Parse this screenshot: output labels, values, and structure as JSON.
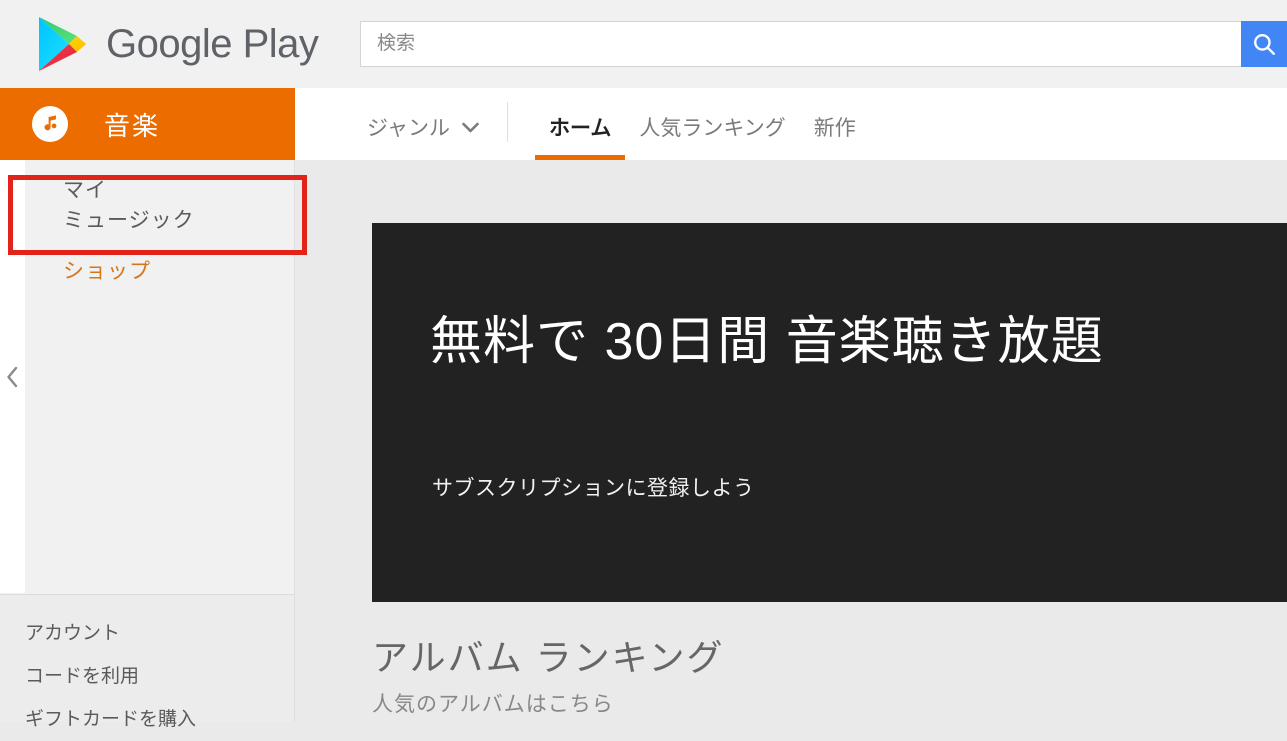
{
  "header": {
    "brand_name": "Google Play",
    "logo_icon": "google-play-triangle-icon",
    "search": {
      "placeholder": "検索",
      "value": "",
      "button_icon": "search-icon",
      "button_color": "#4285f4"
    }
  },
  "corpus": {
    "icon": "music-note-icon",
    "title": "音楽",
    "bar_color": "#ec6c00"
  },
  "nav": {
    "genre": {
      "label": "ジャンル",
      "caret_icon": "chevron-down-icon"
    },
    "tabs": [
      {
        "label": "ホーム",
        "active": true
      },
      {
        "label": "人気ランキング",
        "active": false
      },
      {
        "label": "新作",
        "active": false
      }
    ],
    "active_underline_color": "#ec6c00"
  },
  "sidebar": {
    "collapse_icon": "chevron-left-icon",
    "items": [
      {
        "label": "マイ\nミュージック",
        "line1": "マイ",
        "line2": "ミュージック",
        "highlighted": true
      },
      {
        "label": "ショップ",
        "highlighted": false
      }
    ],
    "footer_items": [
      {
        "label": "アカウント"
      },
      {
        "label": "コードを利用"
      },
      {
        "label": "ギフトカードを購入"
      }
    ],
    "highlight_color": "#e2231a",
    "shop_color": "#d4761a"
  },
  "main": {
    "hero": {
      "title": "無料で 30日間 音楽聴き放題",
      "subtitle": "サブスクリプションに登録しよう",
      "background_color": "#222222"
    },
    "section": {
      "title": "アルバム ランキング",
      "subtitle": "人気のアルバムはこちら"
    }
  }
}
